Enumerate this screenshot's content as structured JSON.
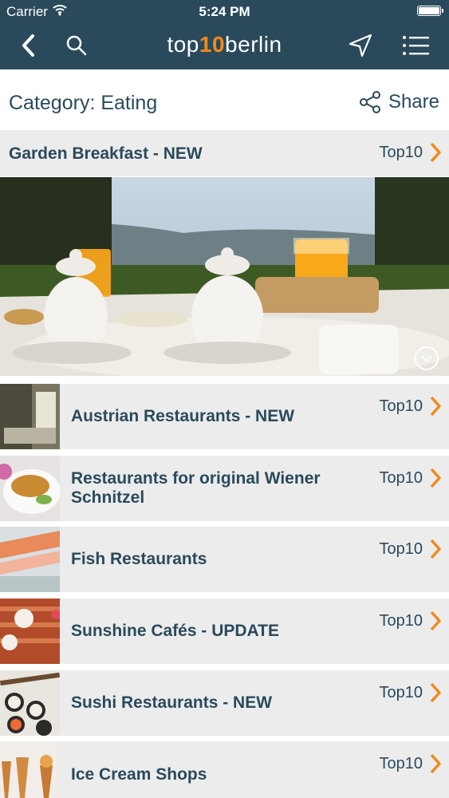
{
  "status_bar": {
    "carrier": "Carrier",
    "time": "5:24 PM"
  },
  "header": {
    "logo_prefix": "top",
    "logo_ten": "10",
    "logo_suffix": "berlin"
  },
  "category": {
    "title": "Category: Eating",
    "share_label": "Share"
  },
  "featured": {
    "title": "Garden Breakfast - NEW",
    "badge": "Top10"
  },
  "items": [
    {
      "title": "Austrian Restaurants - NEW",
      "badge": "Top10"
    },
    {
      "title": "Restaurants for original Wiener Schnitzel",
      "badge": "Top10"
    },
    {
      "title": "Fish Restaurants",
      "badge": "Top10"
    },
    {
      "title": "Sunshine Cafés - UPDATE",
      "badge": "Top10"
    },
    {
      "title": "Sushi Restaurants - NEW",
      "badge": "Top10"
    },
    {
      "title": "Ice Cream Shops",
      "badge": "Top10"
    }
  ],
  "colors": {
    "navbar": "#2a4a5c",
    "accent": "#f08a1c",
    "row_bg": "#ececec",
    "text": "#2a4a5c"
  },
  "icons": [
    "wifi-icon",
    "battery-icon",
    "back-chevron-icon",
    "search-icon",
    "location-arrow-icon",
    "menu-list-icon",
    "share-icon",
    "chevron-right-icon",
    "expand-circle-icon"
  ]
}
